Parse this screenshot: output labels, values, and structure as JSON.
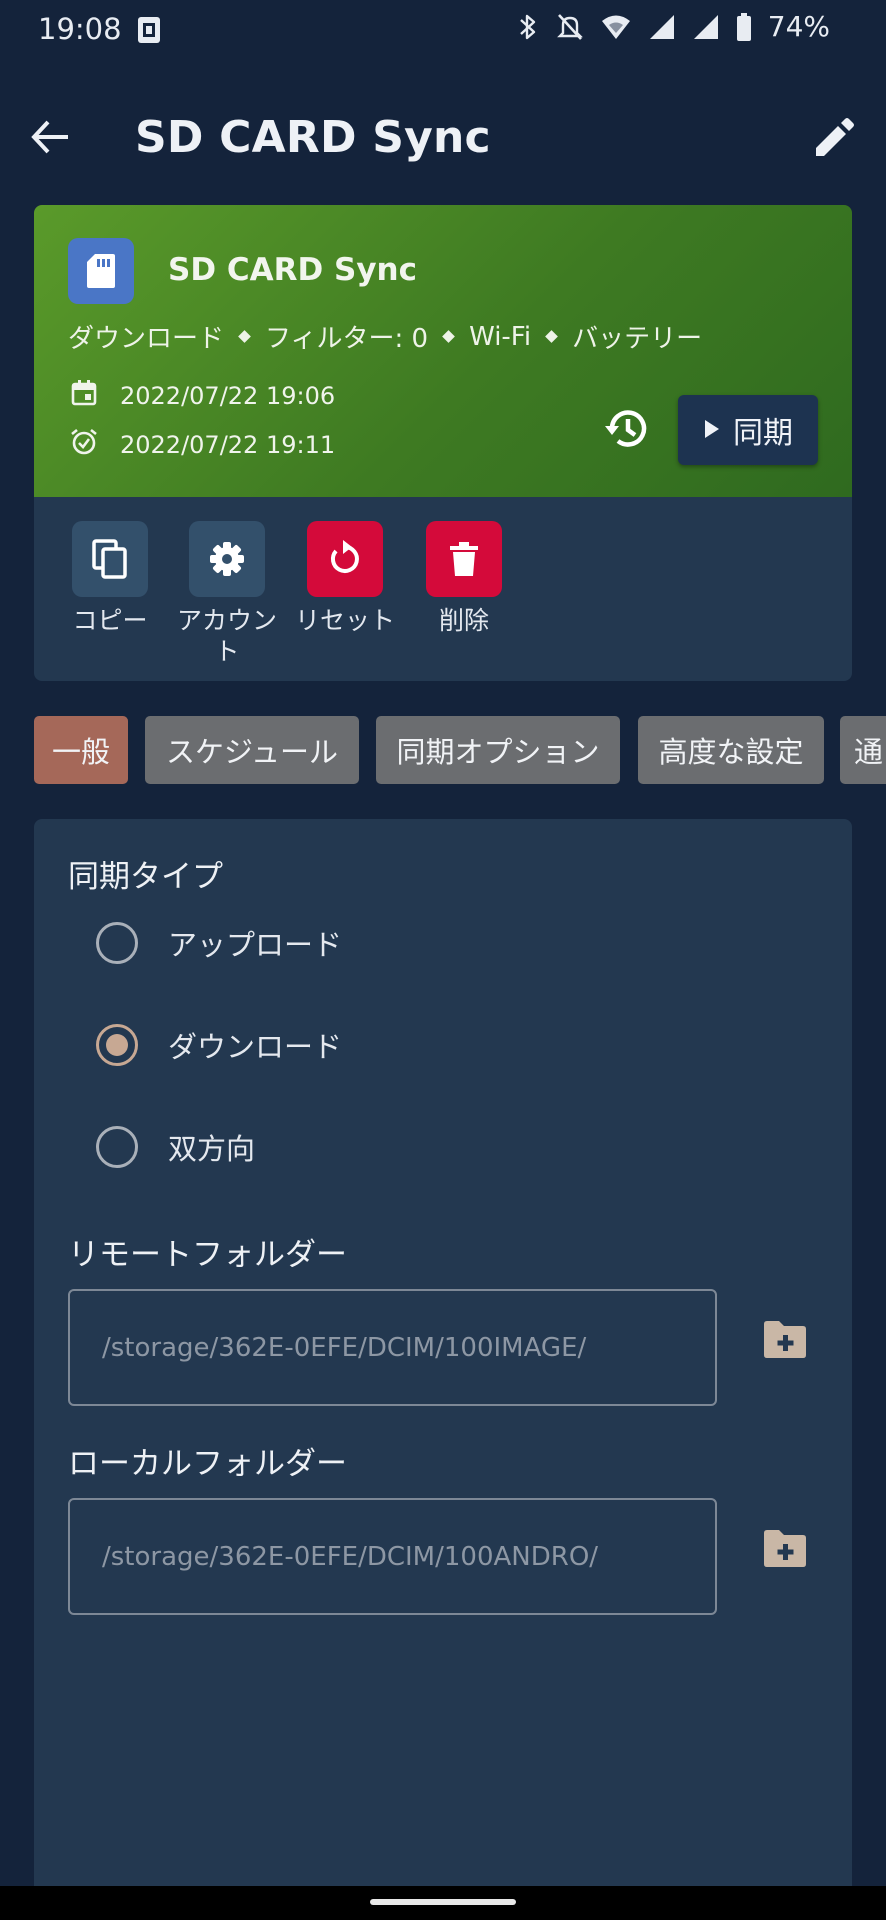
{
  "status_bar": {
    "time": "19:08",
    "battery": "74%",
    "icons": [
      "sim-icon",
      "bluetooth-icon",
      "notifications-off-icon",
      "wifi-icon",
      "signal-icon",
      "signal-icon",
      "battery-icon"
    ]
  },
  "app_bar": {
    "title": "SD CARD Sync",
    "icons": [
      "back-arrow-icon",
      "edit-pencil-icon"
    ]
  },
  "profile_card": {
    "name": "SD CARD Sync",
    "icon": "sd-card-icon",
    "meta": [
      "ダウンロード",
      "フィルター: 0",
      "Wi-Fi",
      "バッテリー"
    ],
    "last_sync": "2022/07/22 19:06",
    "next_sync": "2022/07/22 19:11",
    "sync_label": "同期",
    "colors": {
      "top": "#4e8a26",
      "bottom": "#233850",
      "icon_bg": "#4a76c6"
    }
  },
  "actions": [
    {
      "label": "コピー",
      "icon": "copy-icon",
      "style": "neutral"
    },
    {
      "label": "アカウント",
      "icon": "gear-icon",
      "style": "neutral"
    },
    {
      "label": "リセット",
      "icon": "reset-icon",
      "style": "danger"
    },
    {
      "label": "削除",
      "icon": "trash-icon",
      "style": "danger"
    }
  ],
  "tabs": [
    {
      "label": "一般",
      "active": true
    },
    {
      "label": "スケジュール",
      "active": false
    },
    {
      "label": "同期オプション",
      "active": false
    },
    {
      "label": "高度な設定",
      "active": false
    },
    {
      "label": "通",
      "active": false
    }
  ],
  "general": {
    "sync_type_label": "同期タイプ",
    "sync_types": [
      {
        "label": "アップロード",
        "checked": false
      },
      {
        "label": "ダウンロード",
        "checked": true
      },
      {
        "label": "双方向",
        "checked": false
      }
    ],
    "remote_folder_label": "リモートフォルダー",
    "remote_folder_placeholder": "/storage/362E-0EFE/DCIM/100IMAGE/",
    "local_folder_label": "ローカルフォルダー",
    "local_folder_placeholder": "/storage/362E-0EFE/DCIM/100ANDRO/"
  },
  "accent_colors": {
    "danger": "#d40a3a",
    "active_tab": "#a56859",
    "radio": "#c7a893",
    "folder_icon": "#c9b7a6"
  }
}
